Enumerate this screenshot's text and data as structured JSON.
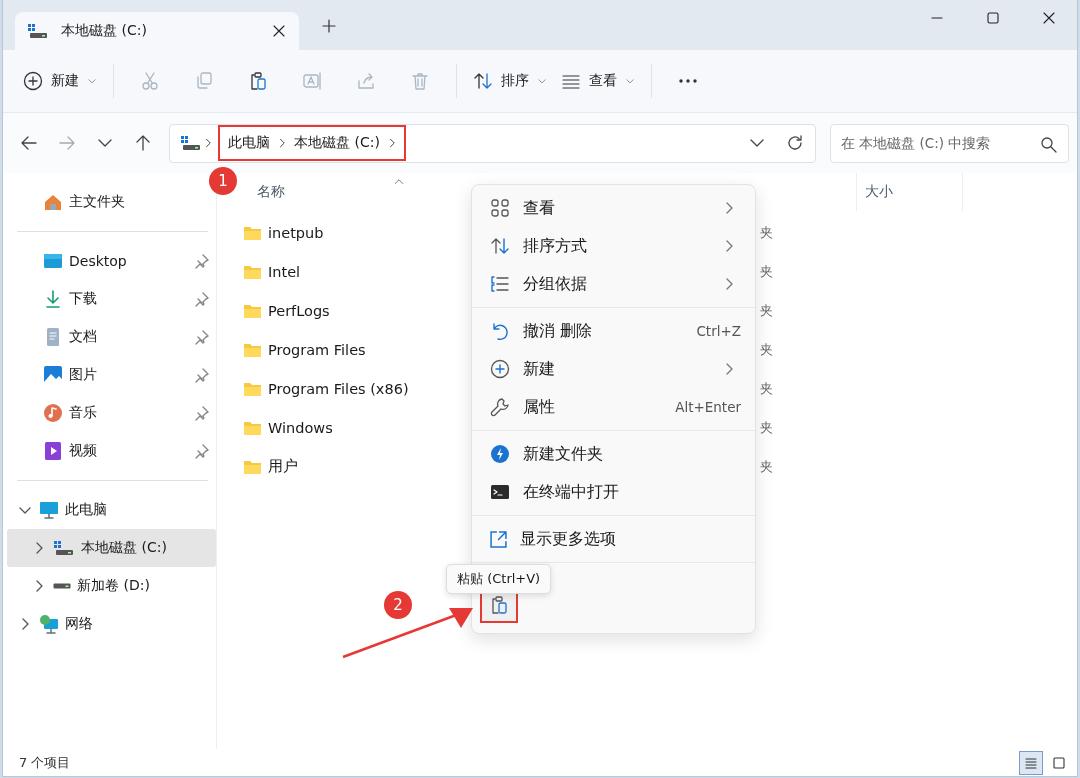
{
  "tab": {
    "title": "本地磁盘 (C:)",
    "selected": true
  },
  "toolbar": [
    {
      "kind": "new",
      "label": "新建",
      "disabled": false
    },
    {
      "kind": "cut",
      "disabled": true
    },
    {
      "kind": "copy",
      "disabled": true
    },
    {
      "kind": "paste",
      "disabled": false
    },
    {
      "kind": "rename",
      "disabled": true
    },
    {
      "kind": "share",
      "disabled": true
    },
    {
      "kind": "delete",
      "disabled": true
    },
    {
      "kind": "sort",
      "label": "排序",
      "disabled": false
    },
    {
      "kind": "view",
      "label": "查看",
      "disabled": false
    },
    {
      "kind": "more",
      "disabled": false
    }
  ],
  "address": {
    "path": [
      "此电脑",
      "本地磁盘 (C:)"
    ]
  },
  "search": {
    "placeholder": "在 本地磁盘 (C:) 中搜索"
  },
  "sidebar": {
    "quick": [
      {
        "kind": "home",
        "label": "主文件夹"
      }
    ],
    "pinned": [
      {
        "kind": "desktop",
        "label": "Desktop",
        "pinned": true
      },
      {
        "kind": "download",
        "label": "下载",
        "pinned": true
      },
      {
        "kind": "document",
        "label": "文档",
        "pinned": true
      },
      {
        "kind": "picture",
        "label": "图片",
        "pinned": true
      },
      {
        "kind": "music",
        "label": "音乐",
        "pinned": true
      },
      {
        "kind": "video",
        "label": "视频",
        "pinned": true
      }
    ],
    "tree": [
      {
        "kind": "pc",
        "label": "此电脑",
        "expanded": true,
        "selected": false,
        "children": [
          {
            "kind": "drive_c",
            "label": "本地磁盘 (C:)",
            "expanded": false,
            "selected": true
          },
          {
            "kind": "drive",
            "label": "新加卷 (D:)",
            "expanded": false,
            "selected": false
          }
        ]
      },
      {
        "kind": "network",
        "label": "网络",
        "expanded": false,
        "selected": false
      }
    ]
  },
  "columns": [
    {
      "label": "名称",
      "sorted": true
    },
    {
      "label": "大小",
      "sorted": false
    }
  ],
  "files": [
    {
      "name": "inetpub",
      "column_2": "夹"
    },
    {
      "name": "Intel",
      "column_2": "夹"
    },
    {
      "name": "PerfLogs",
      "column_2": "夹"
    },
    {
      "name": "Program Files",
      "column_2": "夹"
    },
    {
      "name": "Program Files (x86)",
      "column_2": "夹"
    },
    {
      "name": "Windows",
      "column_2": "夹"
    },
    {
      "name": "用户",
      "column_2": "夹"
    }
  ],
  "context_menu": {
    "items": [
      {
        "kind": "view",
        "label": "查看",
        "submenu": true
      },
      {
        "kind": "sort",
        "label": "排序方式",
        "submenu": true
      },
      {
        "kind": "group",
        "label": "分组依据",
        "submenu": true
      },
      {
        "kind": "separator"
      },
      {
        "kind": "undo",
        "label": "撤消 删除",
        "shortcut": "Ctrl+Z",
        "submenu": false
      },
      {
        "kind": "new",
        "label": "新建",
        "submenu": true
      },
      {
        "kind": "properties",
        "label": "属性",
        "shortcut": "Alt+Enter",
        "submenu": false
      },
      {
        "kind": "separator"
      },
      {
        "kind": "newfolder",
        "label": "新建文件夹",
        "submenu": false
      },
      {
        "kind": "terminal",
        "label": "在终端中打开",
        "submenu": false
      },
      {
        "kind": "separator"
      },
      {
        "kind": "more",
        "label": "显示更多选项",
        "submenu": false
      },
      {
        "kind": "separator"
      }
    ],
    "paste_tooltip": "粘贴 (Ctrl+V)"
  },
  "status_bar": {
    "count": "7 个项目",
    "view_modes": [
      {
        "kind": "details",
        "selected": true
      },
      {
        "kind": "tiles",
        "selected": false
      }
    ]
  },
  "annotations": [
    {
      "label": "1"
    },
    {
      "label": "2"
    }
  ]
}
